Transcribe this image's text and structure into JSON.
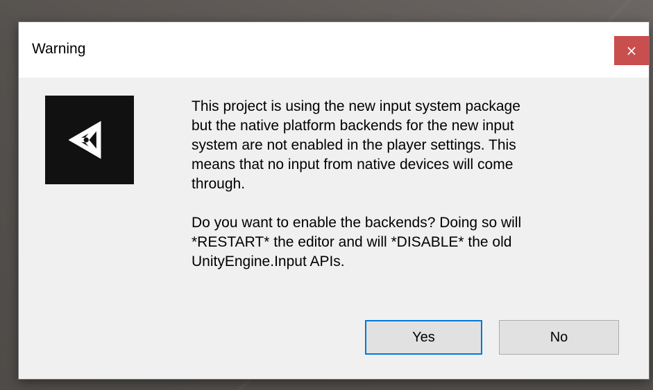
{
  "dialog": {
    "title": "Warning",
    "close_glyph": "×",
    "logo_icon": "unity-logo-icon",
    "message_paragraphs": [
      "This project is using the new input system package\nbut the native platform backends for the new input\nsystem are not enabled in the player settings. This\nmeans that no input from native devices will come\nthrough.",
      "Do you want to enable the backends? Doing so will\n*RESTART* the editor and will *DISABLE* the old\nUnityEngine.Input APIs."
    ],
    "buttons": {
      "yes_label": "Yes",
      "no_label": "No"
    },
    "colors": {
      "close_button_bg": "#c94e4e",
      "focus_border": "#0078d7",
      "body_bg": "#f0f0f0",
      "titlebar_bg": "#ffffff"
    }
  }
}
